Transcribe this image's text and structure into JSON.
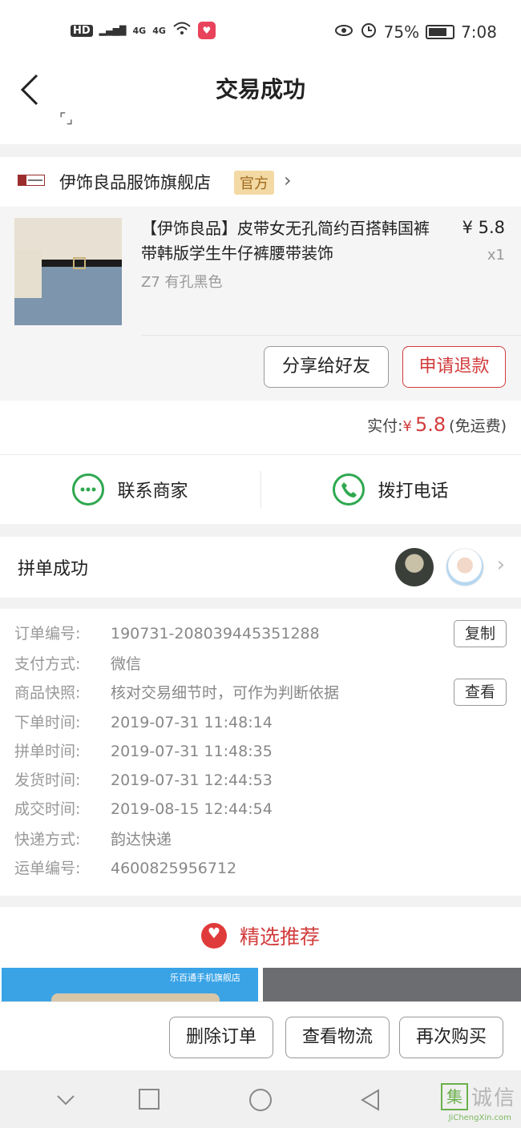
{
  "status_bar": {
    "left_hd": "HD",
    "left_sig1": "4G",
    "left_sig2": "4G",
    "battery_pct": "75%",
    "time": "7:08"
  },
  "nav": {
    "title": "交易成功",
    "cut_text": "⌜⌟"
  },
  "store": {
    "name": "伊饰良品服饰旗舰店",
    "badge": "官方",
    "chevron": "›"
  },
  "goods": {
    "title": "【伊饰良品】皮带女无孔简约百搭韩国裤带韩版学生牛仔裤腰带装饰",
    "spec": "Z7 有孔黑色",
    "price": "¥ 5.8",
    "qty": "x1",
    "share_label": "分享给好友",
    "refund_label": "申请退款"
  },
  "payment": {
    "label": "实付:",
    "yen": "¥",
    "amount": "5.8",
    "note": "(免运费)"
  },
  "contact": {
    "merchant_label": "联系商家",
    "phone_label": "拨打电话"
  },
  "group": {
    "label": "拼单成功"
  },
  "order_info": {
    "rows": [
      {
        "key": "订单编号:",
        "value": "190731-208039445351288"
      },
      {
        "key": "支付方式:",
        "value": "微信"
      },
      {
        "key": "商品快照:",
        "value": "核对交易细节时，可作为判断依据"
      },
      {
        "key": "下单时间:",
        "value": "2019-07-31 11:48:14"
      },
      {
        "key": "拼单时间:",
        "value": "2019-07-31 11:48:35"
      },
      {
        "key": "发货时间:",
        "value": "2019-07-31 12:44:53"
      },
      {
        "key": "成交时间:",
        "value": "2019-08-15 12:44:54"
      },
      {
        "key": "快递方式:",
        "value": "韵达快递"
      },
      {
        "key": "运单编号:",
        "value": "4600825956712"
      }
    ],
    "copy_label": "复制",
    "view_label": "查看"
  },
  "recommend": {
    "title": "精选推荐",
    "shop_caption": "乐百通手机旗舰店"
  },
  "bottom_actions": {
    "delete_label": "删除订单",
    "logistics_label": "查看物流",
    "rebuy_label": "再次购买"
  },
  "watermark": {
    "box": "集",
    "text": "诚信",
    "sub": "JiChengXin.com"
  },
  "colors": {
    "accent_red": "#d23c3c",
    "green": "#2fa84f",
    "badge_bg": "#f3d9a3"
  }
}
